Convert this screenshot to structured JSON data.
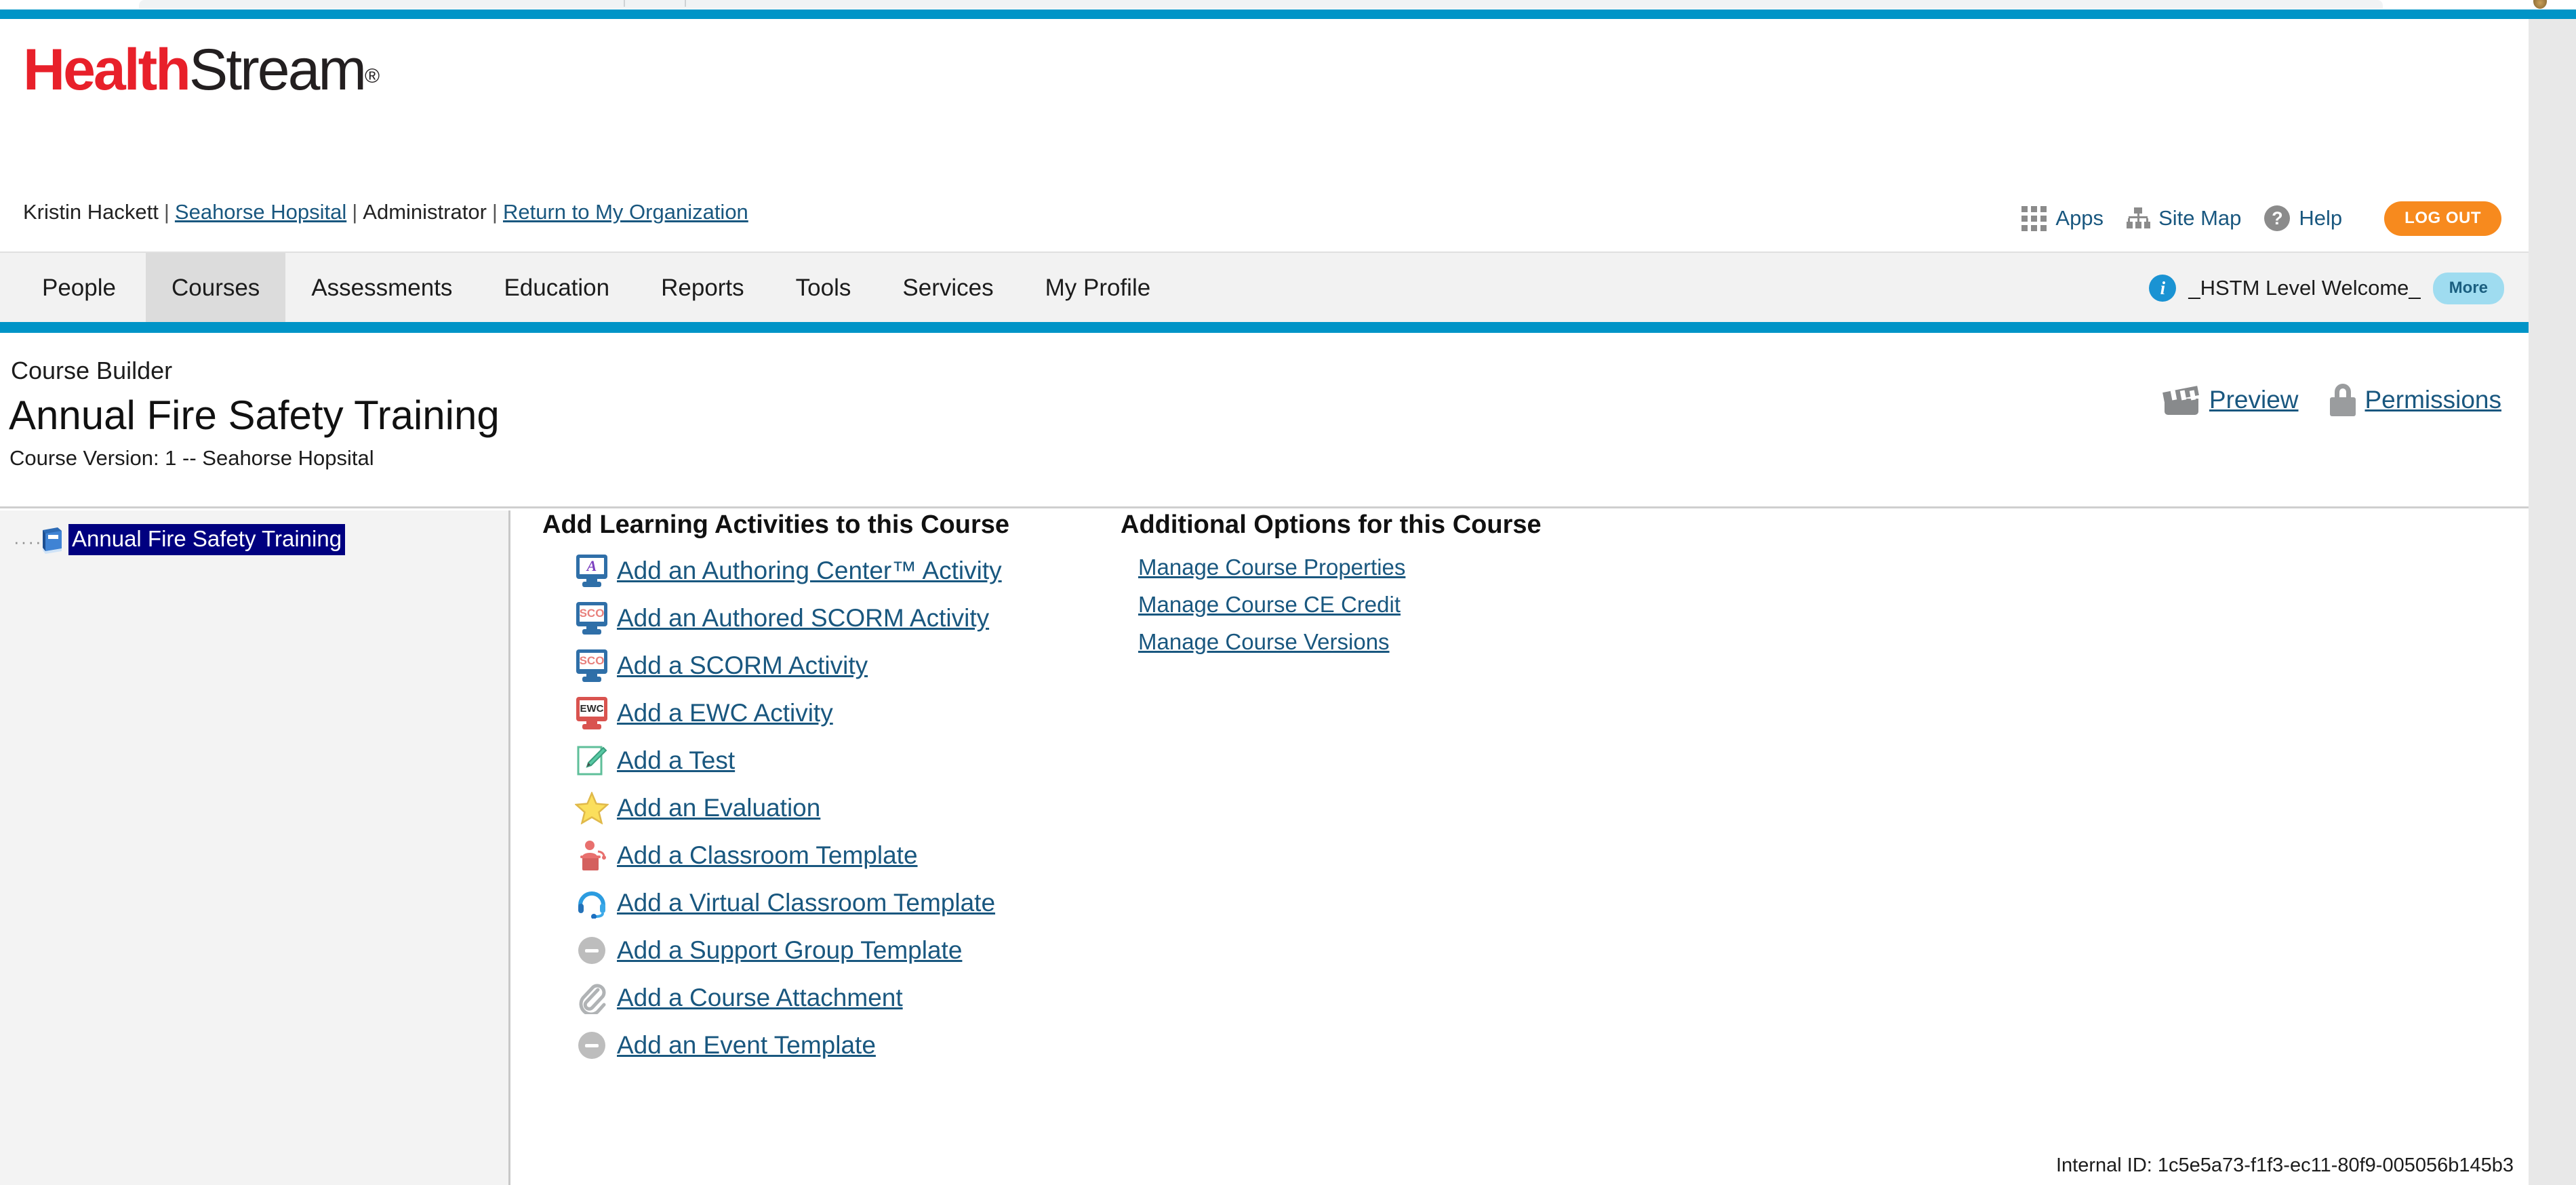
{
  "brand": {
    "logo_part1": "Health",
    "logo_part2": "Stream",
    "logo_registered": "®",
    "accent_blue": "#0094c7",
    "brand_red": "#e8202a",
    "link_blue": "#19577f",
    "logout_orange": "#f78a1e"
  },
  "utility": {
    "user_name": "Kristin Hackett",
    "separator": "|",
    "organization": "Seahorse Hopsital",
    "role": "Administrator",
    "return_link": "Return to My Organization",
    "apps_label": "Apps",
    "sitemap_label": "Site Map",
    "help_label": "Help",
    "logout_label": "LOG OUT"
  },
  "nav": {
    "tabs": [
      {
        "label": "People",
        "active": false
      },
      {
        "label": "Courses",
        "active": true
      },
      {
        "label": "Assessments",
        "active": false
      },
      {
        "label": "Education",
        "active": false
      },
      {
        "label": "Reports",
        "active": false
      },
      {
        "label": "Tools",
        "active": false
      },
      {
        "label": "Services",
        "active": false
      },
      {
        "label": "My Profile",
        "active": false
      }
    ],
    "welcome_message": "_HSTM Level Welcome_",
    "more_label": "More",
    "info_glyph": "i"
  },
  "course_header": {
    "section_label": "Course Builder",
    "course_title": "Annual Fire Safety Training",
    "version_line": "Course Version: 1 -- Seahorse Hopsital",
    "preview_label": "Preview",
    "permissions_label": "Permissions"
  },
  "tree": {
    "dots": "·····",
    "root_label": "Annual Fire Safety Training"
  },
  "activities": {
    "title": "Add Learning Activities to this Course",
    "items": [
      {
        "label": "Add an Authoring Center™ Activity",
        "icon": "authoring-center-icon"
      },
      {
        "label": "Add an Authored SCORM Activity",
        "icon": "authored-scorm-icon"
      },
      {
        "label": "Add a SCORM Activity",
        "icon": "scorm-icon"
      },
      {
        "label": "Add a EWC Activity",
        "icon": "ewc-icon"
      },
      {
        "label": "Add a Test",
        "icon": "test-icon"
      },
      {
        "label": "Add an Evaluation",
        "icon": "star-icon"
      },
      {
        "label": "Add a Classroom Template",
        "icon": "podium-icon"
      },
      {
        "label": "Add a Virtual Classroom Template",
        "icon": "headset-icon"
      },
      {
        "label": "Add a Support Group Template",
        "icon": "minus-circle-icon"
      },
      {
        "label": "Add a Course Attachment",
        "icon": "paperclip-icon"
      },
      {
        "label": "Add an Event Template",
        "icon": "minus-circle-icon"
      }
    ],
    "icon_text": {
      "authoring_center": "A",
      "scorm": "SCO",
      "ewc": "EWC"
    }
  },
  "options": {
    "title": "Additional Options for this Course",
    "items": [
      {
        "label": "Manage Course Properties"
      },
      {
        "label": "Manage Course CE Credit"
      },
      {
        "label": "Manage Course Versions"
      }
    ]
  },
  "footer": {
    "internal_id": "Internal ID: 1c5e5a73-f1f3-ec11-80f9-005056b145b3"
  }
}
